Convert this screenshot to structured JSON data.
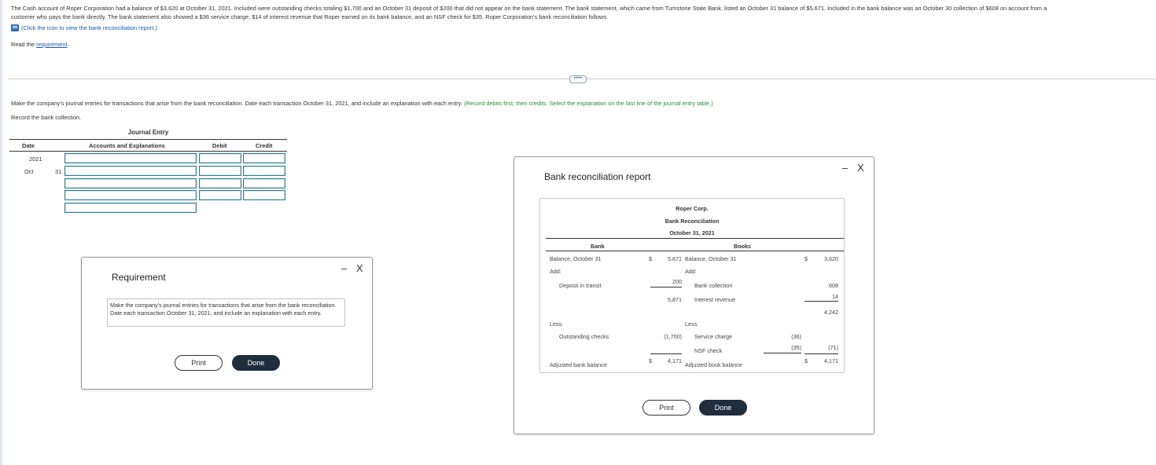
{
  "problem": {
    "intro_line1": "The Cash account of Roper Corporation had a balance of $3,620 at October 31, 2021. Included were outstanding checks totaling $1,700 and an October 31 deposit of $200 that did not appear on the bank statement. The bank statement, which came from Turnstone State Bank, listed an October 31 balance of $5,671. Included in the bank balance was an October 30 collection of $608 on account from a",
    "intro_line2": "customer who pays the bank directly. The bank statement also showed a $36 service charge, $14 of interest revenue that Roper earned on its bank balance, and an NSF check for $35. Roper Corporation's bank reconciliation follows.",
    "icon_link": "(Click the icon to view the bank reconciliation report.)",
    "read_prefix": "Read the ",
    "read_link": "requirement",
    "read_suffix": ".",
    "instruction": "Make the company's journal entries for transactions that arise from the bank reconciliation. Date each transaction October 31, 2021, and include an explanation with each entry.",
    "instruction_hint": "(Record debits first, then credits. Select the explanation on the last line of the journal entry table.)",
    "record_label": "Record the bank collection."
  },
  "journal": {
    "title": "Journal Entry",
    "col_date": "Date",
    "col_accounts": "Accounts and Explanations",
    "col_debit": "Debit",
    "col_credit": "Credit",
    "year": "2021",
    "month": "Oct",
    "day": "31"
  },
  "requirement_modal": {
    "title": "Requirement",
    "text": "Make the company's journal entries for transactions that arise from the bank reconciliation. Date each transaction October 31, 2021, and include an explanation with each entry.",
    "print": "Print",
    "done": "Done",
    "minimize": "–",
    "close": "X"
  },
  "report_modal": {
    "title": "Bank reconciliation report",
    "company": "Roper Corp.",
    "report_name": "Bank Reconciliation",
    "date": "October 31, 2021",
    "bank_header": "Bank",
    "books_header": "Books",
    "bank": {
      "balance_label": "Balance, October 31",
      "balance_dollar": "$",
      "balance_value": "5,671",
      "add_label": "Add:",
      "deposit_label": "Deposit in transit",
      "deposit_value": "200",
      "subtotal": "5,871",
      "less_label": "Less:",
      "outstanding_label": "Outstanding checks",
      "outstanding_value": "(1,700)",
      "adjusted_label": "Adjusted bank balance",
      "adjusted_dollar": "$",
      "adjusted_value": "4,171"
    },
    "books": {
      "balance_label": "Balance, October 31",
      "balance_dollar": "$",
      "balance_value": "3,620",
      "add_label": "Add:",
      "collection_label": "Bank collection",
      "collection_value": "608",
      "interest_label": "Interest revenue",
      "interest_value": "14",
      "subtotal": "4,242",
      "less_label": "Less:",
      "service_label": "Service charge",
      "service_value": "(36)",
      "nsf_label": "NSF check",
      "nsf_value": "(35)",
      "nsf_total": "(71)",
      "adjusted_label": "Adjusted book balance",
      "adjusted_dollar": "$",
      "adjusted_value": "4,171"
    },
    "print": "Print",
    "done": "Done",
    "minimize": "–",
    "close": "X"
  },
  "colors": {
    "link": "#1a5aa6",
    "hint_green": "#2f8a3a",
    "input_border": "#2c7c8e",
    "done_button": "#1f2d3d"
  }
}
